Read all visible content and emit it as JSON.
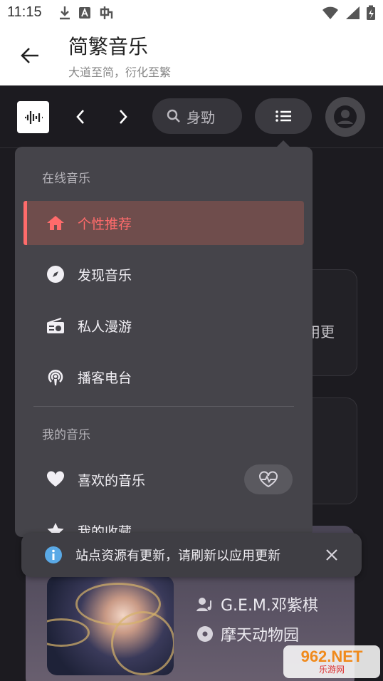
{
  "status_bar": {
    "time": "11:15"
  },
  "app_header": {
    "title": "简繁音乐",
    "subtitle": "大道至简，衍化至繁"
  },
  "search": {
    "placeholder": "身勁"
  },
  "menu": {
    "online_label": "在线音乐",
    "online_items": [
      {
        "label": "个性推荐",
        "icon": "home-icon",
        "active": true
      },
      {
        "label": "发现音乐",
        "icon": "compass-icon",
        "active": false
      },
      {
        "label": "私人漫游",
        "icon": "radio-icon",
        "active": false
      },
      {
        "label": "播客电台",
        "icon": "podcast-icon",
        "active": false
      }
    ],
    "mine_label": "我的音乐",
    "mine_items": [
      {
        "label": "喜欢的音乐",
        "icon": "heart-icon"
      },
      {
        "label": "我的收藏",
        "icon": "star-icon"
      }
    ]
  },
  "background": {
    "partial_text": "用更"
  },
  "now_playing": {
    "artist": "G.E.M.邓紫棋",
    "album": "摩天动物园"
  },
  "toast": {
    "message": "站点资源有更新，请刷新以应用更新"
  },
  "watermark": {
    "top": "962.NET",
    "bottom": "乐游网"
  },
  "colors": {
    "accent": "#ff6b6b",
    "menu_bg": "#45444a",
    "app_bg": "#1c1b20"
  }
}
